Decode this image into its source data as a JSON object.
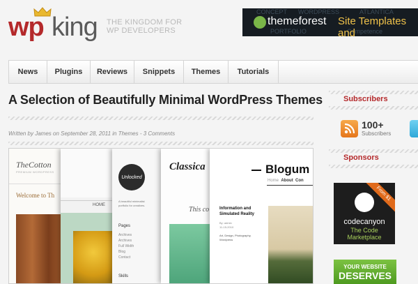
{
  "header": {
    "logo_wp": "wp",
    "logo_king": "king",
    "tagline_line1": "THE KINGDOM FOR",
    "tagline_line2": "WP DEVELOPERS"
  },
  "banner": {
    "brand": "themeforest",
    "text": "Site Templates and",
    "bg_words": [
      "CONCEPT",
      "WORDPRESS",
      "ATLANTICA",
      "Competence",
      "PORTFOLIO"
    ]
  },
  "nav": {
    "items": [
      "News",
      "Plugins",
      "Reviews",
      "Snippets",
      "Themes",
      "Tutorials"
    ]
  },
  "post": {
    "title": "A Selection of Beautifully Minimal WordPress Themes",
    "meta_prefix": "Written by ",
    "author": "James",
    "meta_on": " on September 28, 2011 in ",
    "category": "Themes",
    "meta_sep": " - ",
    "comments": "3 Comments"
  },
  "collage": {
    "p1": {
      "brand": "TheCotton",
      "sub": "PREMIUM WORDPRESS",
      "welcome": "Welcome to Th"
    },
    "p2": {
      "nav": "HOME"
    },
    "p3": {
      "logo": "Unlocked",
      "desc1": "A beautiful minimalist",
      "desc2": "portfolio for creatives.",
      "pages_title": "Pages",
      "pages": [
        "Archives",
        "Archives",
        "Full Width",
        "Blog",
        "Contact"
      ],
      "skills": "Skills"
    },
    "p4": {
      "brand": "Classica",
      "text": "This co"
    },
    "p5": {
      "brand": "Blogum",
      "nav": [
        "Home",
        "About",
        "Con"
      ],
      "post_title1": "Information and",
      "post_title2": "Simulated Reality",
      "by": "By: admin",
      "date": "11-15-2010",
      "tags1": "Art, Design, Photography,",
      "tags2": "Wordpress"
    }
  },
  "sidebar": {
    "subscribers_title": "Subscribers",
    "subscribers_count": "100+",
    "subscribers_label": "Subscribers",
    "sponsors_title": "Sponsors",
    "codecanyon": {
      "ribbon": "From $1",
      "name": "codecanyon",
      "tag1": "The Code",
      "tag2": "Marketplace"
    },
    "yourwebsite": {
      "line1": "YOUR WEBSITE",
      "line2": "DESERVES"
    }
  },
  "colors": {
    "accent": "#b4292b",
    "banner_bg": "#161c22",
    "themeforest_yellow": "#f0c24a",
    "codecanyon_green": "#a8d05b"
  }
}
